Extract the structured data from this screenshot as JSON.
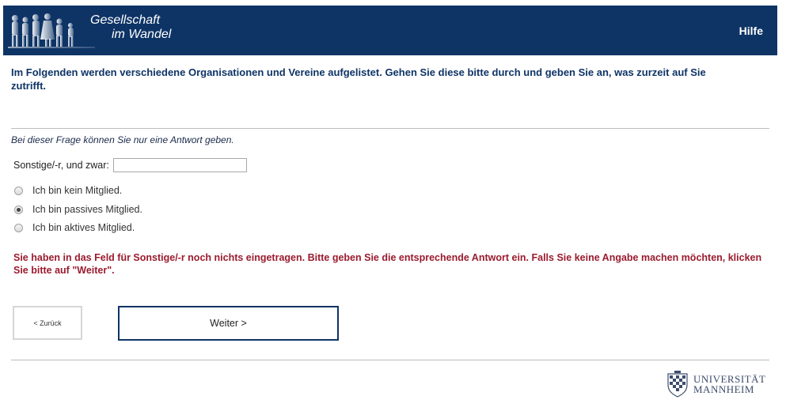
{
  "header": {
    "brand_line1": "Gesellschaft",
    "brand_line2": "im Wandel",
    "help_label": "Hilfe"
  },
  "question": {
    "intro": "Im Folgenden werden verschiedene Organisationen und Vereine aufgelistet. Gehen Sie diese bitte durch und geben Sie an, was zurzeit auf Sie zutrifft.",
    "instruction": "Bei dieser Frage können Sie nur eine Antwort geben.",
    "other_label": "Sonstige/-r, und zwar:",
    "other_value": "",
    "options": [
      {
        "label": "Ich bin kein Mitglied.",
        "selected": false
      },
      {
        "label": "Ich bin passives Mitglied.",
        "selected": true
      },
      {
        "label": "Ich bin aktives Mitglied.",
        "selected": false
      }
    ],
    "error": "Sie haben in das Feld für Sonstige/-r noch nichts eingetragen. Bitte geben Sie die entsprechende Antwort ein. Falls Sie keine Angabe machen möchten, klicken Sie bitte auf \"Weiter\"."
  },
  "nav": {
    "back_label": "< Zurück",
    "next_label": "Weiter >"
  },
  "footer": {
    "uni_line1": "UNIVERSITÄT",
    "uni_line2": "MANNHEIM"
  },
  "colors": {
    "header_bg": "#0e3466",
    "error_text": "#9b1b2e"
  }
}
